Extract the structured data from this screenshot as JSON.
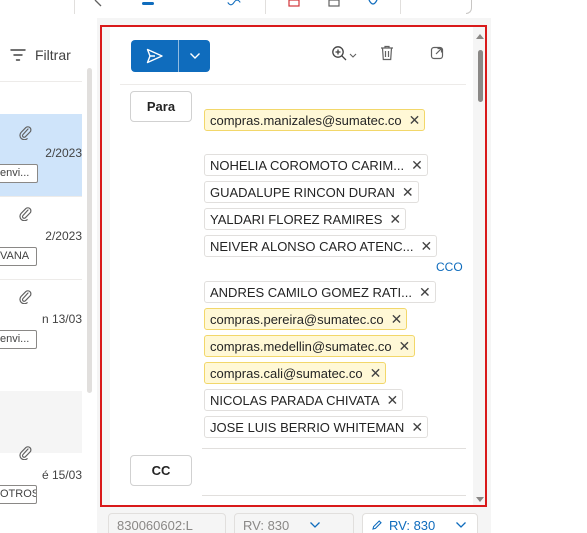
{
  "list": {
    "filter_label": "Filtrar",
    "items": [
      {
        "date": "2/2023",
        "tag": "envi..."
      },
      {
        "date": "2/2023",
        "tag": "VANA"
      },
      {
        "date": "n 13/03",
        "tag": "envi..."
      },
      {
        "date": "é 15/03",
        "tag": "OTROS"
      }
    ]
  },
  "compose": {
    "to_label": "Para",
    "cc_label": "CC",
    "bcc_label": "CCO",
    "to_recipients": [
      {
        "name": "compras.manizales@sumatec.co",
        "external": true
      },
      {
        "name": "NOHELIA COROMOTO CARIM...",
        "external": false
      },
      {
        "name": "GUADALUPE RINCON DURAN",
        "external": false
      },
      {
        "name": "YALDARI FLOREZ RAMIRES",
        "external": false
      },
      {
        "name": "NEIVER ALONSO CARO ATENC...",
        "external": false
      },
      {
        "name": "ANDRES CAMILO GOMEZ RATI...",
        "external": false
      },
      {
        "name": "compras.pereira@sumatec.co",
        "external": true
      },
      {
        "name": "compras.medellin@sumatec.co",
        "external": true
      },
      {
        "name": "compras.cali@sumatec.co",
        "external": true
      },
      {
        "name": "NICOLAS PARADA CHIVATA",
        "external": false
      },
      {
        "name": "JOSE LUIS BERRIO WHITEMAN",
        "external": false
      }
    ],
    "remove_glyph": "✕"
  },
  "drafts": [
    {
      "label": "830060602:L",
      "active": false
    },
    {
      "label": "RV: 830",
      "active": false
    },
    {
      "label": "RV: 830",
      "active": true
    }
  ],
  "colors": {
    "accent": "#0f6cbd",
    "external_chip": "#fff8d6",
    "selection": "#cfe4fa",
    "highlight_border": "#d9191a"
  },
  "icons": [
    "filter-icon",
    "paperclip-icon",
    "send-icon",
    "chevron-down-icon",
    "zoom-icon",
    "delete-icon",
    "popout-icon"
  ]
}
